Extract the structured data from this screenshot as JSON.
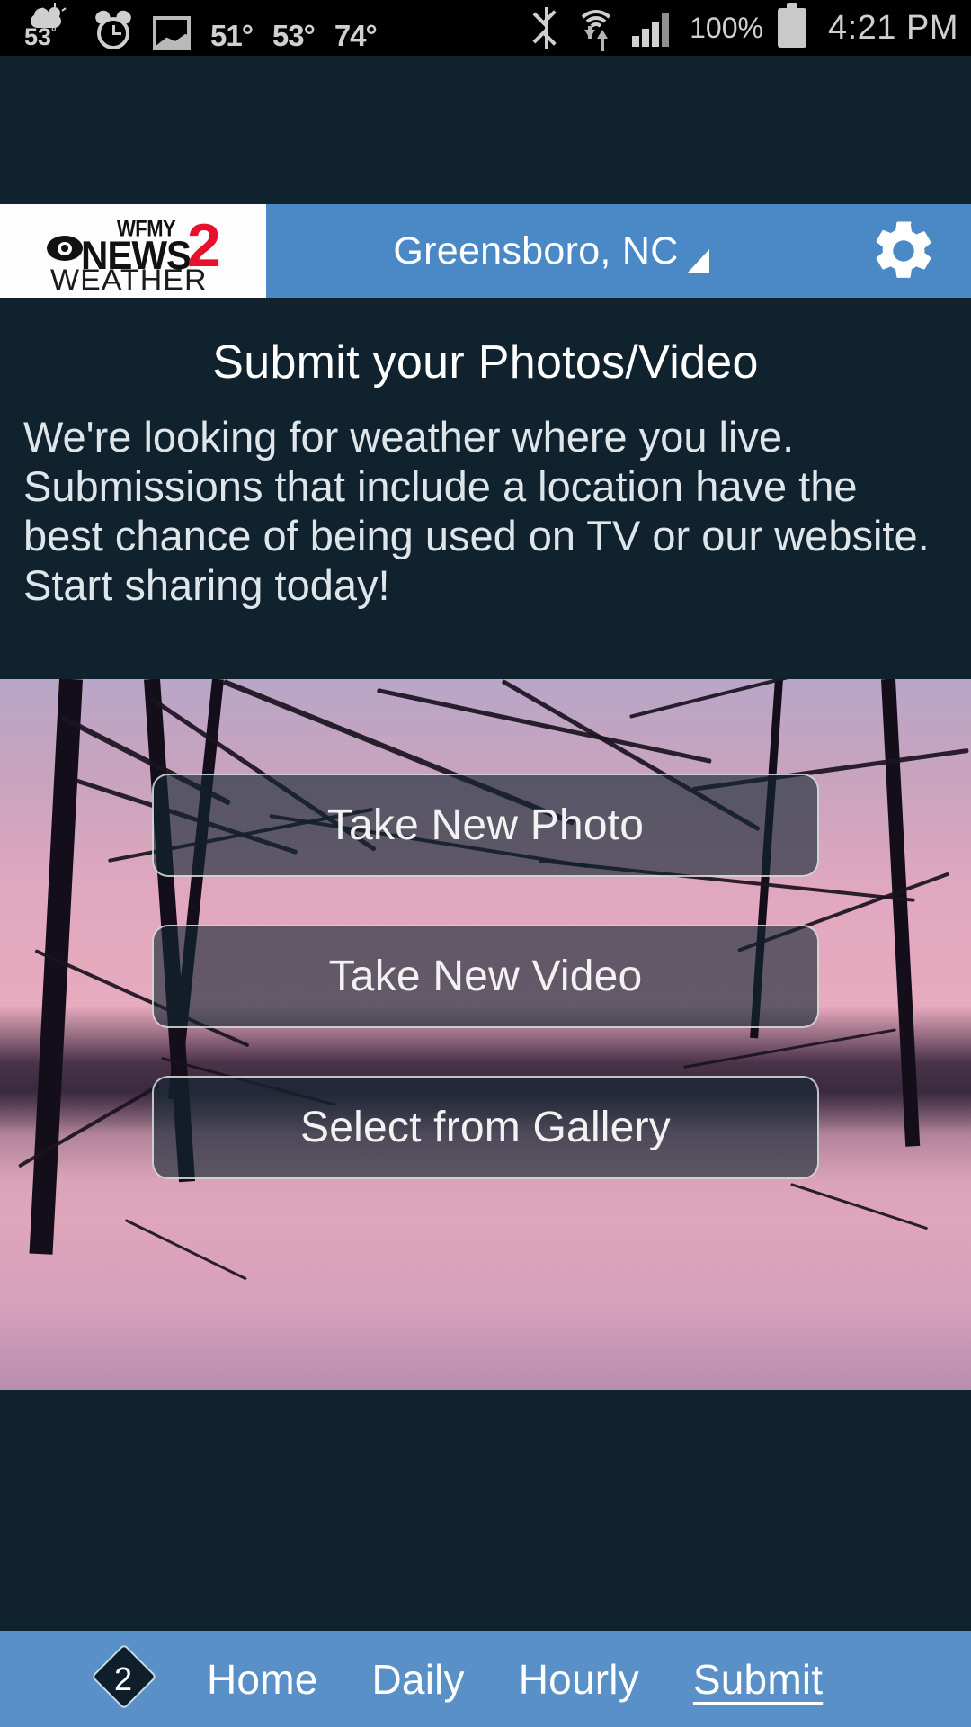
{
  "statusbar": {
    "weather_icon": "partly-cloudy-icon",
    "weather_temp": "53",
    "weather_degree": "°",
    "alarm_icon": "alarm-clock-icon",
    "picture_icon": "picture-icon",
    "temps": [
      "51°",
      "53°",
      "74°"
    ],
    "bluetooth_icon": "bluetooth-icon",
    "wifi_icon": "wifi-icon",
    "signal_icon": "cell-signal-icon",
    "battery_percent": "100%",
    "battery_icon": "battery-full-icon",
    "clock": "4:21 PM"
  },
  "header": {
    "logo": {
      "station": "WFMY",
      "news": "NEWS",
      "channel": "2",
      "weather": "WEATHER",
      "eye_icon": "cbs-eye-icon"
    },
    "location": "Greensboro, NC",
    "caret_icon": "dropdown-caret-icon",
    "settings_icon": "gear-icon",
    "bar_color": "#4a88c6"
  },
  "intro": {
    "title": "Submit your Photos/Video",
    "body": "We're looking for weather where you live. Submissions that include a location have the best chance of being used on TV or our website. Start sharing today!"
  },
  "actions": {
    "buttons": [
      {
        "label": "Take New Photo",
        "name": "take-new-photo-button"
      },
      {
        "label": "Take New Video",
        "name": "take-new-video-button"
      },
      {
        "label": "Select from Gallery",
        "name": "select-from-gallery-button"
      }
    ]
  },
  "bottomnav": {
    "logo_number": "2",
    "logo_icon": "news2-diamond-icon",
    "items": [
      {
        "label": "Home",
        "active": false
      },
      {
        "label": "Daily",
        "active": false
      },
      {
        "label": "Hourly",
        "active": false
      },
      {
        "label": "Submit",
        "active": true
      }
    ],
    "bar_color": "#5a90c8"
  }
}
